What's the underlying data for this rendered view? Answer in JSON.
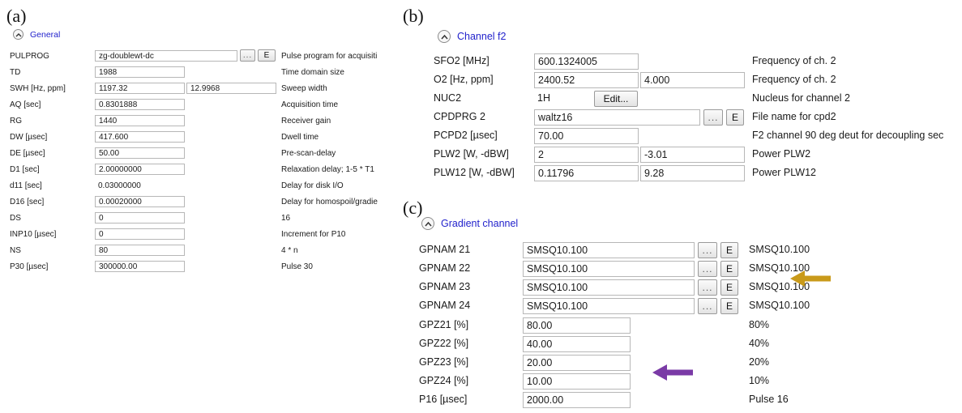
{
  "panels": {
    "a": {
      "letter": "(a)",
      "section_title": "General",
      "section_icon": "chevron-up-icon",
      "browse_label": "...",
      "edit_label": "E",
      "rows": [
        {
          "label": "PULPROG",
          "value": "zg-doublewt-dc",
          "desc": "Pulse program for acquisiti"
        },
        {
          "label": "TD",
          "value": "1988",
          "desc": "Time domain size"
        },
        {
          "label": "SWH [Hz, ppm]",
          "value": "1197.32",
          "value2": "12.9968",
          "desc": "Sweep width"
        },
        {
          "label": "AQ [sec]",
          "value": "0.8301888",
          "desc": "Acquisition time"
        },
        {
          "label": "RG",
          "value": "1440",
          "desc": "Receiver gain"
        },
        {
          "label": "DW [µsec]",
          "value": "417.600",
          "desc": "Dwell time"
        },
        {
          "label": "DE [µsec]",
          "value": "50.00",
          "desc": "Pre-scan-delay"
        },
        {
          "label": "D1 [sec]",
          "value": "2.00000000",
          "desc": "Relaxation delay; 1-5 * T1"
        },
        {
          "label": "d11 [sec]",
          "value": "0.03000000",
          "desc": "Delay for disk I/O"
        },
        {
          "label": "D16 [sec]",
          "value": "0.00020000",
          "desc": "Delay for homospoil/gradie"
        },
        {
          "label": "DS",
          "value": "0",
          "desc": "16"
        },
        {
          "label": "INP10 [µsec]",
          "value": "0",
          "desc": "Increment for P10"
        },
        {
          "label": "NS",
          "value": "80",
          "desc": "4 * n"
        },
        {
          "label": "P30 [µsec]",
          "value": "300000.00",
          "desc": "Pulse 30"
        }
      ]
    },
    "b": {
      "letter": "(b)",
      "section_title": "Channel f2",
      "section_icon": "chevron-up-icon",
      "browse_label": "...",
      "edit_label": "E",
      "edit_button_label": "Edit...",
      "rows": [
        {
          "label": "SFO2 [MHz]",
          "value": "600.1324005",
          "desc": "Frequency of ch. 2"
        },
        {
          "label": "O2 [Hz, ppm]",
          "value": "2400.52",
          "value2": "4.000",
          "desc": "Frequency of ch. 2"
        },
        {
          "label": "NUC2",
          "value": "1H",
          "desc": "Nucleus for channel 2"
        },
        {
          "label": "CPDPRG 2",
          "value": "waltz16",
          "desc": "File name for cpd2"
        },
        {
          "label": "PCPD2 [µsec]",
          "value": "70.00",
          "desc": "F2 channel 90 deg deut for decoupling sec"
        },
        {
          "label": "PLW2 [W, -dBW]",
          "value": "2",
          "value2": "-3.01",
          "desc": "Power PLW2"
        },
        {
          "label": "PLW12 [W, -dBW]",
          "value": "0.11796",
          "value2": "9.28",
          "desc": "Power PLW12"
        }
      ]
    },
    "c": {
      "letter": "(c)",
      "section_title": "Gradient channel",
      "section_icon": "chevron-up-icon",
      "browse_label": "...",
      "edit_label": "E",
      "rows": [
        {
          "label": "GPNAM 21",
          "value": "SMSQ10.100",
          "desc": "SMSQ10.100"
        },
        {
          "label": "GPNAM 22",
          "value": "SMSQ10.100",
          "desc": "SMSQ10.100"
        },
        {
          "label": "GPNAM 23",
          "value": "SMSQ10.100",
          "desc": "SMSQ10.100"
        },
        {
          "label": "GPNAM 24",
          "value": "SMSQ10.100",
          "desc": "SMSQ10.100"
        },
        {
          "label": "GPZ21 [%]",
          "value": "80.00",
          "desc": "80%"
        },
        {
          "label": "GPZ22 [%]",
          "value": "40.00",
          "desc": "40%"
        },
        {
          "label": "GPZ23 [%]",
          "value": "20.00",
          "desc": "20%"
        },
        {
          "label": "GPZ24 [%]",
          "value": "10.00",
          "desc": "10%"
        },
        {
          "label": "P16 [µsec]",
          "value": "2000.00",
          "desc": "Pulse 16"
        }
      ]
    }
  },
  "annotations": {
    "gold_arrow": {
      "color": "#c99a1a",
      "icon": "left-arrow-icon"
    },
    "purple_arrow": {
      "color": "#7a3aa6",
      "icon": "left-arrow-icon"
    }
  }
}
